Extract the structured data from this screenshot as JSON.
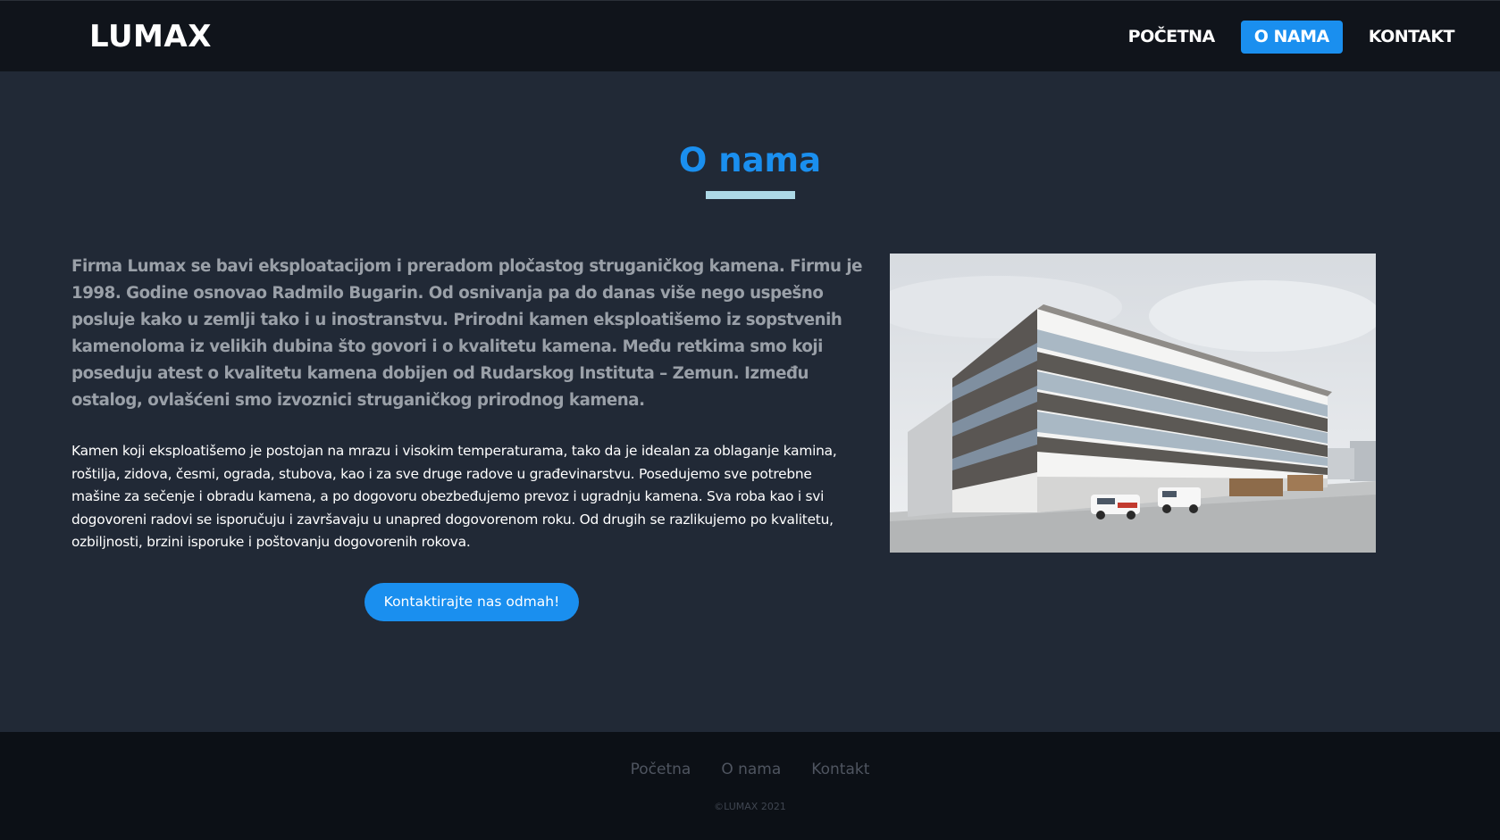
{
  "header": {
    "logo": "LUMAX",
    "nav": [
      {
        "label": "POČETNA",
        "active": false
      },
      {
        "label": "O NAMA",
        "active": true
      },
      {
        "label": "KONTAKT",
        "active": false
      }
    ]
  },
  "main": {
    "title": "O nama",
    "lead": "Firma Lumax se bavi eksploatacijom i preradom pločastog struganičkog kamena. Firmu je 1998. Godine osnovao Radmilo Bugarin. Od osnivanja pa do danas više nego uspešno posluje kako u zemlji tako i u inostranstvu. Prirodni kamen eksploatišemo iz sopstvenih kamenoloma iz velikih dubina što govori i o kvalitetu kamena. Među retkima smo koji poseduju atest o kvalitetu kamena dobijen od Rudarskog Instituta – Zemun. Između ostalog, ovlašćeni smo izvoznici struganičkog prirodnog kamena.",
    "body": "Kamen koji eksploatišemo je postojan na mrazu i visokim temperaturama, tako da je idealan za oblaganje kamina, roštilja, zidova, česmi, ograda, stubova, kao i za sve druge radove u građevinarstvu. Posedujemo sve potrebne mašine za sečenje i obradu kamena, a po dogovoru obezbeđujemo prevoz i ugradnju kamena. Sva roba kao i svi dogovoreni radovi se isporučuju i završavaju u unapred dogovorenom roku. Od drugih se razlikujemo po kvalitetu, ozbiljnosti, brzini isporuke i poštovanju dogovorenih rokova.",
    "cta_label": "Kontaktirajte nas odmah!"
  },
  "footer": {
    "links": [
      "Početna",
      "O nama",
      "Kontakt"
    ],
    "copyright": "©LUMAX 2021"
  },
  "colors": {
    "accent": "#1a8fef",
    "header_bg": "#10141b",
    "main_bg": "#212936",
    "footer_bg": "#0c1016",
    "rule": "#add8e6"
  }
}
